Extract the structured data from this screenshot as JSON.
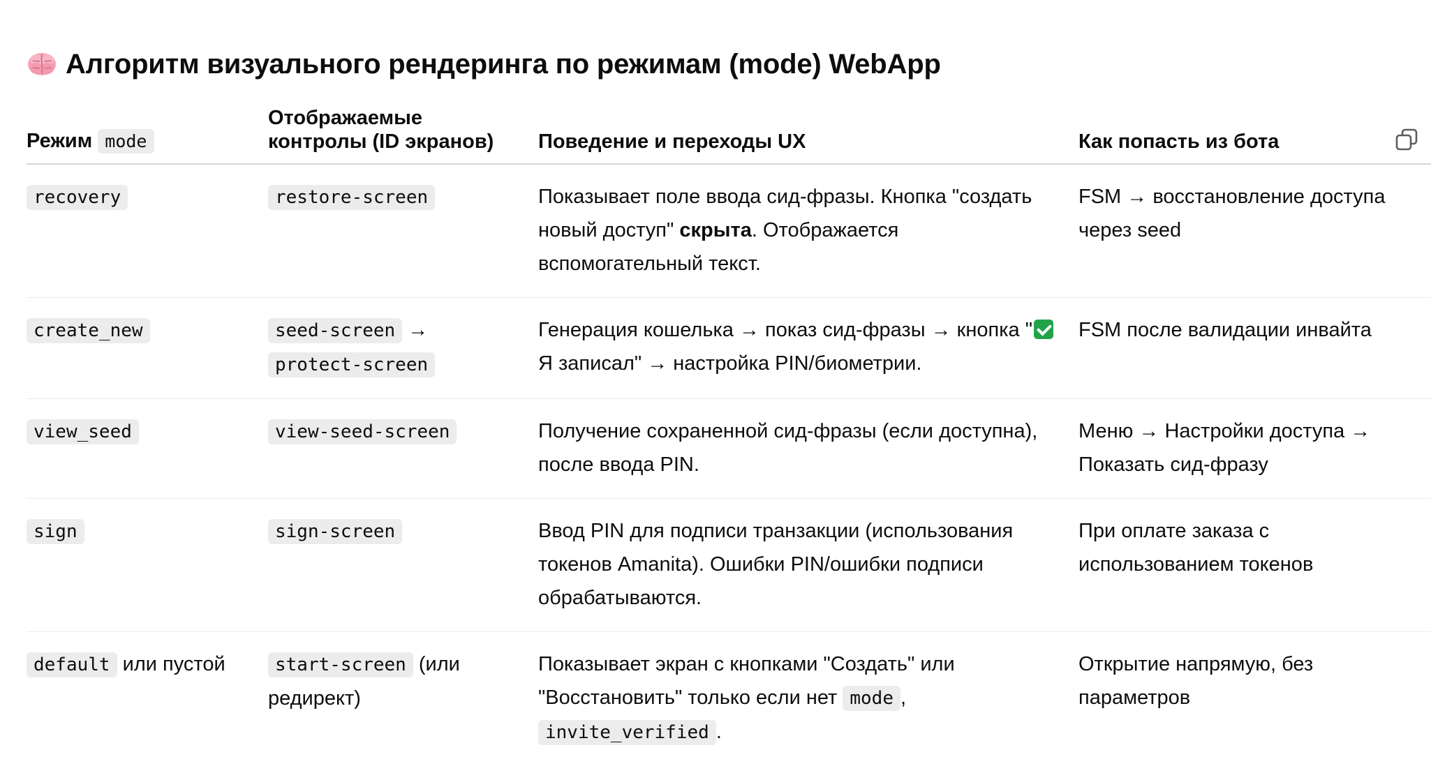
{
  "title": "Алгоритм визуального рендеринга по режимам (mode) WebApp",
  "icons": {
    "title_icon": "brain-icon",
    "copy": "copy-icon",
    "check": "check-mark-icon"
  },
  "table": {
    "headers": {
      "mode_label": "Режим",
      "mode_code": "mode",
      "controls_line1": "Отображаемые",
      "controls_line2": "контролы (ID экранов)",
      "behavior": "Поведение и переходы UX",
      "bot": "Как попасть из бота"
    },
    "rows": [
      {
        "mode": "recovery",
        "screen": "restore-screen",
        "behavior_1": "Показывает поле ввода сид-фразы. Кнопка \"создать новый доступ\" ",
        "behavior_bold": "скрыта",
        "behavior_2": ". Отображается вспомогательный текст.",
        "bot": "FSM → восстановление доступа через seed"
      },
      {
        "mode": "create_new",
        "screen_1": "seed-screen",
        "screen_arrow": " →",
        "screen_2": "protect-screen",
        "behavior_1": "Генерация кошелька → показ сид-фразы → кнопка \"",
        "behavior_2": " Я записал\" → настройка PIN/биометрии.",
        "bot": "FSM после валидации инвайта"
      },
      {
        "mode": "view_seed",
        "screen": "view-seed-screen",
        "behavior": "Получение сохраненной сид-фразы (если доступна), после ввода PIN.",
        "bot": "Меню → Настройки доступа → Показать сид-фразу"
      },
      {
        "mode": "sign",
        "screen": "sign-screen",
        "behavior": "Ввод PIN для подписи транзакции (использования токенов Amanita). Ошибки PIN/ошибки подписи обрабатываются.",
        "bot": "При оплате заказа с использованием токенов"
      },
      {
        "mode": "default",
        "mode_suffix": " или пустой",
        "screen": "start-screen",
        "screen_suffix": " (или редирект)",
        "behavior_1": "Показывает экран с кнопками \"Создать\" или \"Восстановить\" только если нет ",
        "behavior_code_1": "mode",
        "behavior_sep": ", ",
        "behavior_code_2": "invite_verified",
        "behavior_end": ".",
        "bot": "Открытие напрямую, без параметров"
      }
    ]
  }
}
